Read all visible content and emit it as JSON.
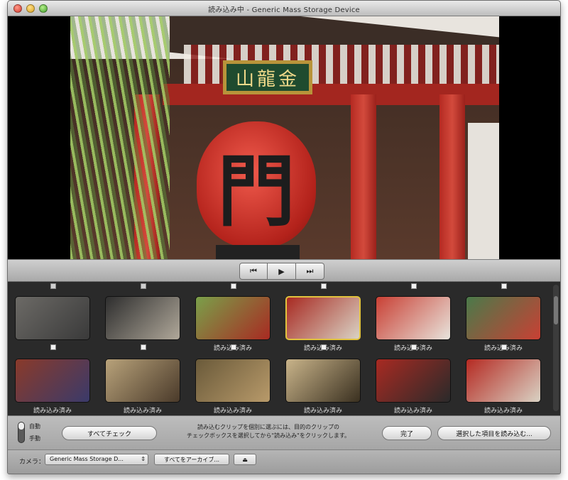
{
  "window": {
    "title": "読み込み中 - Generic Mass Storage Device"
  },
  "preview": {
    "sign_text": "山龍金",
    "lantern_text": "門"
  },
  "transport": {
    "prev_icon": "skip-back-icon",
    "prev_glyph": "⏮",
    "play_icon": "play-icon",
    "play_glyph": "▶",
    "next_icon": "skip-forward-icon",
    "next_glyph": "⏭"
  },
  "clips": {
    "row1": [
      {
        "label": "",
        "checked": false,
        "selected": false,
        "colors": [
          "#6c6a66",
          "#3a3a3a"
        ]
      },
      {
        "label": "",
        "checked": false,
        "selected": false,
        "colors": [
          "#2e2e2e",
          "#b0a89a"
        ]
      },
      {
        "label": "読み込み済み",
        "checked": true,
        "selected": false,
        "colors": [
          "#7aa04a",
          "#a82a22"
        ]
      },
      {
        "label": "読み込み済み",
        "checked": true,
        "selected": true,
        "colors": [
          "#a82a22",
          "#d9d2c4"
        ]
      },
      {
        "label": "読み込み済み",
        "checked": true,
        "selected": false,
        "colors": [
          "#c94034",
          "#e8e4dc"
        ]
      },
      {
        "label": "読み込み済み",
        "checked": true,
        "selected": false,
        "colors": [
          "#4a7a4a",
          "#c94034"
        ]
      }
    ],
    "row2": [
      {
        "label": "読み込み済み",
        "checked": true,
        "selected": false,
        "colors": [
          "#8a3a2a",
          "#3a3a6a"
        ]
      },
      {
        "label": "読み込み済み",
        "checked": true,
        "selected": false,
        "colors": [
          "#b8a27a",
          "#4a3a2a"
        ]
      },
      {
        "label": "読み込み済み",
        "checked": true,
        "selected": false,
        "colors": [
          "#6a5a3a",
          "#b89a6a"
        ]
      },
      {
        "label": "読み込み済み",
        "checked": true,
        "selected": false,
        "colors": [
          "#c9b48a",
          "#3a3020"
        ]
      },
      {
        "label": "読み込み済み",
        "checked": true,
        "selected": false,
        "colors": [
          "#a82a22",
          "#2a2a2a"
        ]
      },
      {
        "label": "読み込み済み",
        "checked": true,
        "selected": false,
        "colors": [
          "#b52a22",
          "#d9d2c4"
        ]
      }
    ]
  },
  "controls": {
    "mode_auto": "自動",
    "mode_manual": "手動",
    "check_all": "すべてチェック",
    "help_line1": "読み込むクリップを個別に選ぶには、目的のクリップの",
    "help_line2": "チェックボックスを選択してから\"読み込み\"をクリックします。",
    "done": "完了",
    "import_selected": "選択した項目を読み込む..."
  },
  "status": {
    "camera_label": "カメラ：",
    "camera_value": "Generic Mass Storage D...",
    "archive_all": "すべてをアーカイブ...",
    "eject_icon": "eject-icon",
    "eject_glyph": "⏏"
  }
}
